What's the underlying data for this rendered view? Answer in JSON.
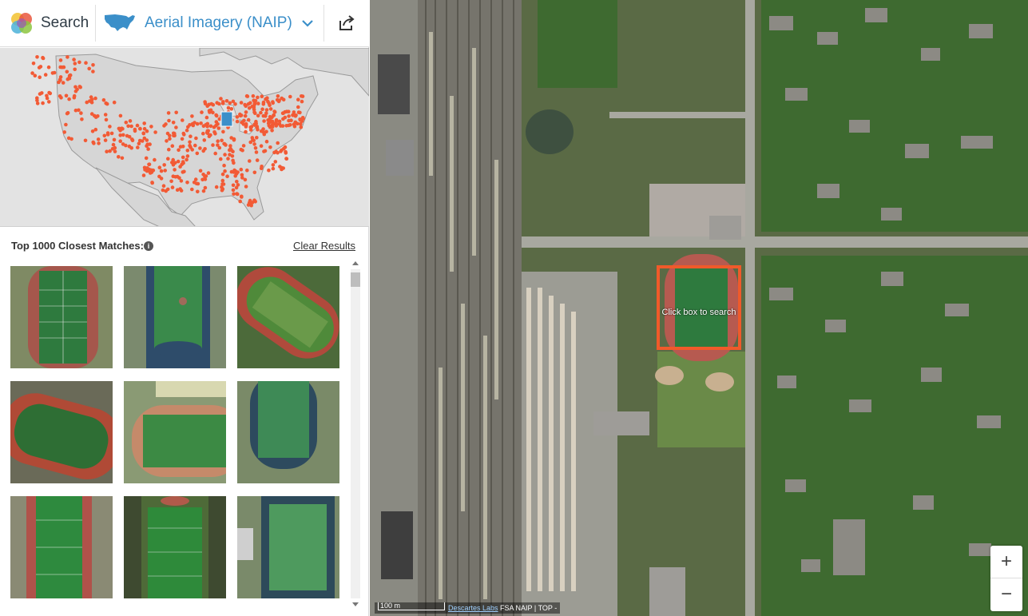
{
  "header": {
    "search_label": "Search",
    "dataset_label": "Aerial Imagery (NAIP)",
    "icons": {
      "logo": "descartes-logo-icon",
      "dataset": "us-map-icon",
      "dropdown": "chevron-down-icon",
      "share": "share-icon"
    }
  },
  "results": {
    "title": "Top 1000 Closest Matches:",
    "info_icon": "info-icon",
    "clear_label": "Clear Results"
  },
  "map": {
    "search_box_text": "Click box to search",
    "zoom_in": "+",
    "zoom_out": "−",
    "scale_label": "100 m",
    "attribution_link": "Descartes Labs",
    "attribution_text": "FSA NAIP | TOP -",
    "colors": {
      "search_box": "#f05a2a",
      "match_dots": "#f25a35",
      "overview_highlight": "#3b8fc9"
    }
  },
  "thumbnails": [
    {
      "label": "match-1"
    },
    {
      "label": "match-2"
    },
    {
      "label": "match-3"
    },
    {
      "label": "match-4"
    },
    {
      "label": "match-5"
    },
    {
      "label": "match-6"
    },
    {
      "label": "match-7"
    },
    {
      "label": "match-8"
    },
    {
      "label": "match-9"
    }
  ]
}
